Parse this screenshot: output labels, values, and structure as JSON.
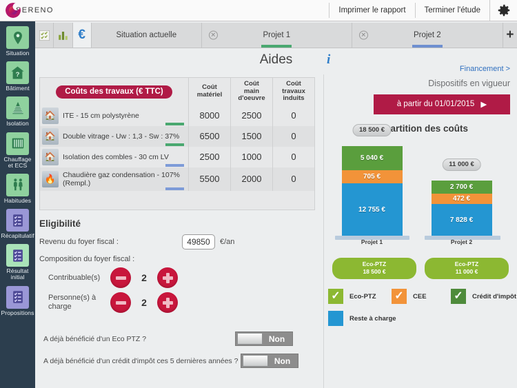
{
  "topbar": {
    "logo_text": "SERENO",
    "actions": [
      {
        "label": "Imprimer le rapport"
      },
      {
        "label": "Terminer l'étude"
      }
    ],
    "gear_icon": "gear-icon"
  },
  "sidebar": {
    "items": [
      {
        "label": "Situation",
        "icon": "location-pin-icon",
        "style": "green"
      },
      {
        "label": "Bâtiment",
        "icon": "house-question-icon",
        "style": "green"
      },
      {
        "label": "Isolation",
        "icon": "insulation-layers-icon",
        "style": "green"
      },
      {
        "label": "Chauffage\net ECS",
        "icon": "radiator-icon",
        "style": "green"
      },
      {
        "label": "Habitudes",
        "icon": "people-icon",
        "style": "green"
      },
      {
        "label": "Récapitulatif",
        "icon": "checklist-icon",
        "style": "purple"
      },
      {
        "label": "Résultat\ninitial",
        "icon": "checklist-icon",
        "style": "lightgreen"
      },
      {
        "label": "Propositions",
        "icon": "checklist-icon",
        "style": "purple"
      }
    ]
  },
  "tabbar": {
    "icon_tabs": [
      {
        "name": "checklist-tab",
        "glyph": "✓",
        "active": false
      },
      {
        "name": "chart-tab",
        "glyph": "█",
        "active": false
      },
      {
        "name": "euro-tab",
        "glyph": "€",
        "active": true
      }
    ],
    "project_tabs": [
      {
        "label": "Situation actuelle",
        "closable": false,
        "underline": ""
      },
      {
        "label": "Projet 1",
        "closable": true,
        "underline": "#4aa870"
      },
      {
        "label": "Projet 2",
        "closable": true,
        "underline": "#6e8fd0"
      }
    ],
    "add_label": "+"
  },
  "page": {
    "title": "Aides",
    "info_icon": "info-icon",
    "financement_link": "Financement >"
  },
  "cost_table": {
    "badge": "Coûts des travaux (€ TTC)",
    "headers": [
      "Coût matériel",
      "Coût main d'oeuvre",
      "Coût travaux induits"
    ],
    "headers_split": [
      {
        "l1": "Coût",
        "l2": "matériel"
      },
      {
        "l1": "Coût",
        "l2": "main d'oeuvre"
      },
      {
        "l1": "Coût",
        "l2": "travaux induits"
      }
    ],
    "rows": [
      {
        "icon": "house-icon",
        "name": "ITE - 15 cm polystyrène",
        "materiel": "8000",
        "oeuvre": "2500",
        "induits": "0",
        "marker": "#4aa870"
      },
      {
        "icon": "window-house-icon",
        "name": "Double vitrage - Uw : 1,3 - Sw : 37%",
        "materiel": "6500",
        "oeuvre": "1500",
        "induits": "0",
        "marker": "#4aa870"
      },
      {
        "icon": "roof-house-icon",
        "name": "Isolation des combles - 30 cm LV",
        "materiel": "2500",
        "oeuvre": "1000",
        "induits": "0",
        "marker": "#7d9bd8"
      },
      {
        "icon": "flame-icon",
        "name": "Chaudière gaz condensation - 107% (Rempl.)",
        "materiel": "5500",
        "oeuvre": "2000",
        "induits": "0",
        "marker": "#7d9bd8"
      }
    ]
  },
  "eligibilite": {
    "title": "Eligibilité",
    "income_label": "Revenu du foyer fiscal :",
    "income_value": "49850",
    "income_unit": "€/an",
    "composition_label": "Composition du foyer fiscal :",
    "steppers": [
      {
        "label": "Contribuable(s)",
        "value": "2"
      },
      {
        "label": "Personne(s) à charge",
        "value": "2"
      }
    ],
    "questions": [
      {
        "label": "A déjà bénéficié d'un Eco PTZ ?",
        "value": "Non"
      },
      {
        "label": "A déjà bénéficié d'un crédit d'impôt ces 5 dernières années ?",
        "value": "Non"
      }
    ]
  },
  "right_panel": {
    "dispositifs_label": "Dispositifs en vigueur",
    "date_button": "à partir du 01/01/2015",
    "date_button_arrow": "▶",
    "pills": [
      {
        "name": "Eco-PTZ",
        "amount": "18 500 €"
      },
      {
        "name": "Eco-PTZ",
        "amount": "11 000 €"
      }
    ],
    "legend": [
      {
        "label": "Eco-PTZ",
        "color": "#8cb832",
        "check": "✓"
      },
      {
        "label": "CEE",
        "color": "#f29339",
        "check": "✓"
      },
      {
        "label": "Crédit d'impôt",
        "color": "#4e8b3b",
        "check": "✓"
      },
      {
        "label": "Reste à charge",
        "color": "#2496d2",
        "check": ""
      }
    ]
  },
  "chart_data": {
    "type": "bar",
    "stacked": true,
    "title": "Répartition des coûts",
    "xlabel": "",
    "ylabel": "",
    "categories": [
      "Projet 1",
      "Projet 2"
    ],
    "totals": [
      18500,
      11000
    ],
    "total_labels": [
      "18 500 €",
      "11 000 €"
    ],
    "series": [
      {
        "name": "Eco-PTZ",
        "color": "#5a9e3d",
        "values": [
          5040,
          2700
        ],
        "labels": [
          "5 040 €",
          "2 700 €"
        ]
      },
      {
        "name": "CEE",
        "color": "#f29339",
        "values": [
          705,
          472
        ],
        "labels": [
          "705 €",
          "472 €"
        ]
      },
      {
        "name": "Reste à charge",
        "color": "#2496d2",
        "values": [
          12755,
          7828
        ],
        "labels": [
          "12 755 €",
          "7 828 €"
        ]
      }
    ],
    "ylim": [
      0,
      18500
    ],
    "grid": false,
    "legend_position": "bottom"
  }
}
